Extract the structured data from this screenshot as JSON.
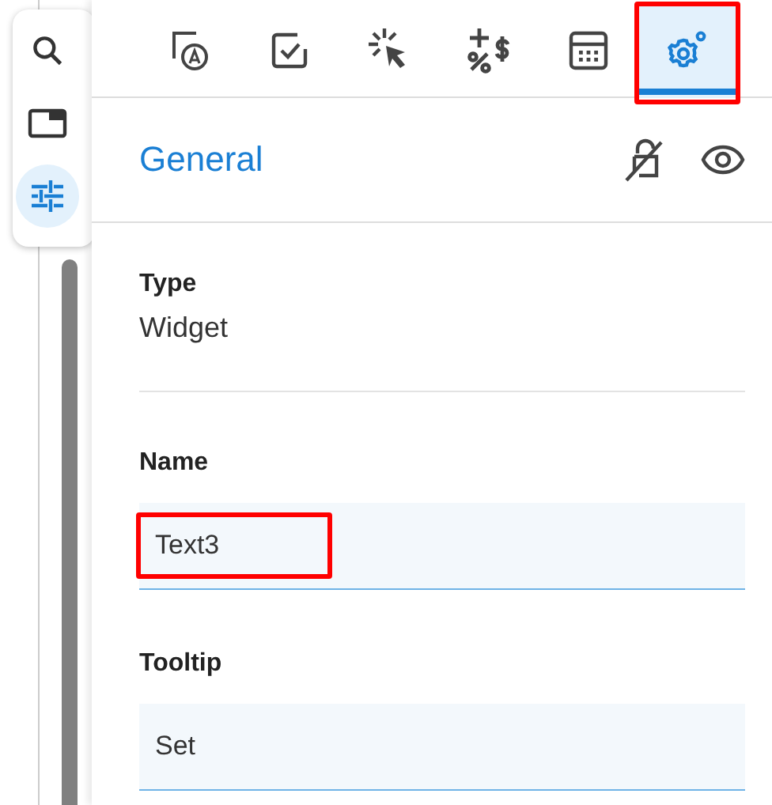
{
  "rail": [
    {
      "selected": false
    },
    {
      "selected": false
    },
    {
      "selected": true
    }
  ],
  "tabs": [
    {
      "selected": false,
      "highlighted": false
    },
    {
      "selected": false,
      "highlighted": false
    },
    {
      "selected": false,
      "highlighted": false
    },
    {
      "selected": false,
      "highlighted": false
    },
    {
      "selected": false,
      "highlighted": false
    },
    {
      "selected": true,
      "highlighted": true
    }
  ],
  "section": {
    "title": "General"
  },
  "info": {
    "label": "Type",
    "value": "Widget"
  },
  "fields": [
    {
      "label": "Name",
      "value": "Text3",
      "highlighted": true
    },
    {
      "label": "Tooltip",
      "value": "Set",
      "highlighted": false
    }
  ]
}
